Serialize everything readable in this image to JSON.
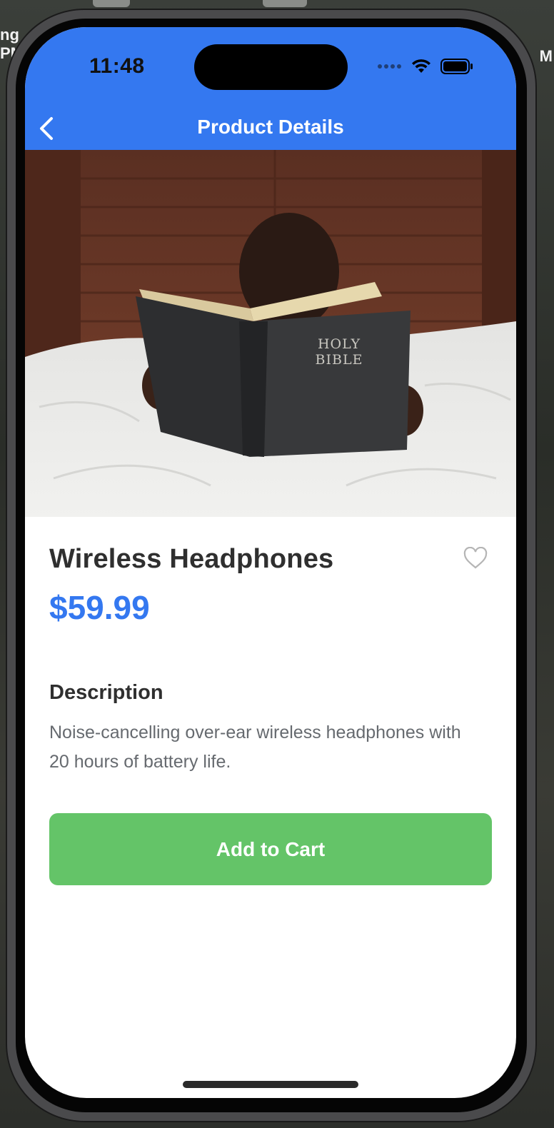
{
  "desktop": {
    "left_fragment_1": "ng",
    "left_fragment_2": "PM",
    "right_fragment": "M"
  },
  "status_bar": {
    "time": "11:48",
    "icons": [
      "signal-dots-icon",
      "wifi-icon",
      "battery-icon"
    ]
  },
  "nav": {
    "back_icon": "chevron-left-icon",
    "title": "Product Details"
  },
  "product": {
    "image_caption": "HOLY BIBLE",
    "title": "Wireless Headphones",
    "price": "$59.99",
    "favorite_icon": "heart-outline-icon",
    "description_heading": "Description",
    "description": "Noise-cancelling over-ear wireless headphones with 20 hours of battery life.",
    "add_to_cart_label": "Add to Cart"
  },
  "colors": {
    "header": "#3478f0",
    "price": "#3478f0",
    "cart_button": "#64c468",
    "title_text": "#2f2f2f",
    "body_text": "#666a6f"
  }
}
